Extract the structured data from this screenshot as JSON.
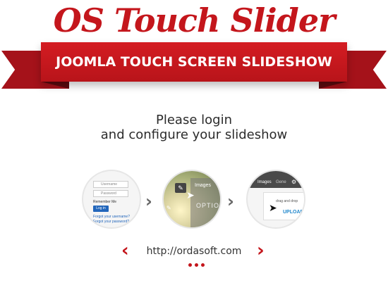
{
  "brand": {
    "title": "OS Touch Slider",
    "subtitle": "JOOMLA TOUCH SCREEN SLIDESHOW",
    "accent_color": "#c4161c"
  },
  "message": {
    "line1": "Please login",
    "line2": "and configure your slideshow"
  },
  "steps": [
    {
      "name": "login",
      "username_placeholder": "Username",
      "password_placeholder": "Password",
      "remember_label": "Remember Me",
      "login_button": "Log in",
      "forgot_username": "Forgot your username?",
      "forgot_password": "Forgot your password?"
    },
    {
      "name": "images",
      "panel_label": "Images",
      "options_label": "OPTION"
    },
    {
      "name": "upload",
      "tab_images": "Images",
      "tab_general": "Gene",
      "drag_text": "drag and drop",
      "upload_label": "UPLOAD"
    }
  ],
  "footer": {
    "url": "http://ordasoft.com",
    "prev_icon": "chevron-left-icon",
    "next_icon": "chevron-right-icon",
    "dots_count": 3
  }
}
